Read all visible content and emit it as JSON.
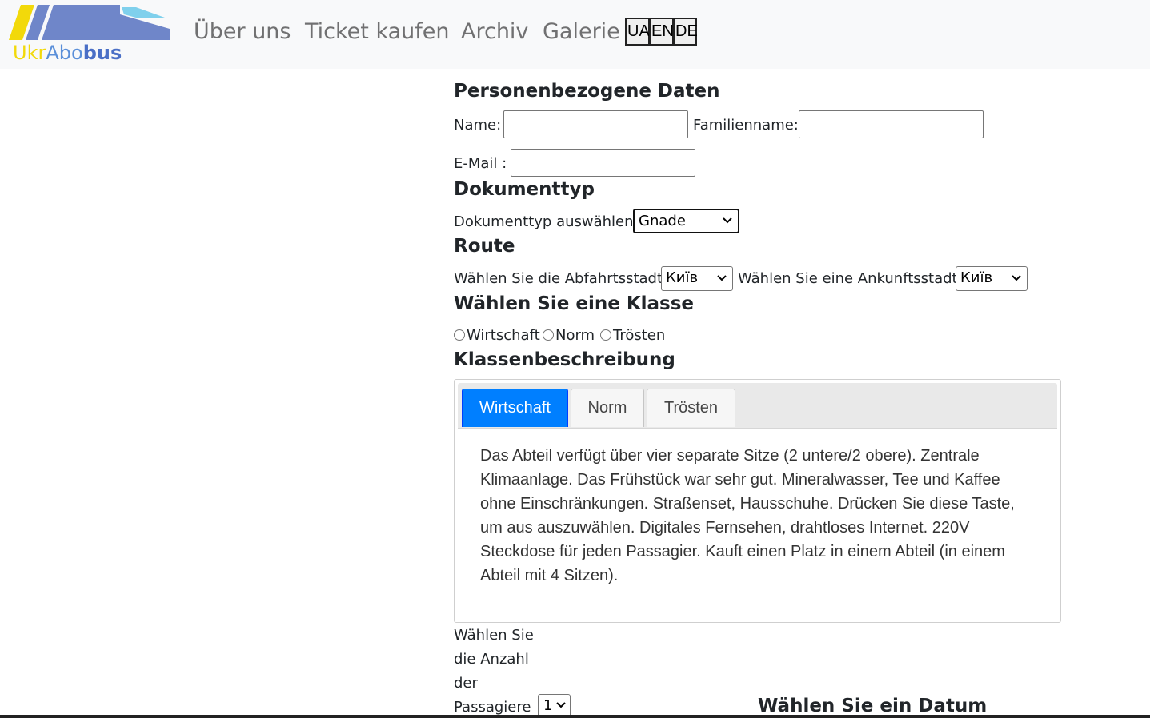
{
  "brand": {
    "logo_text_ukr": "Ukr",
    "logo_text_abo": "Abo",
    "logo_text_bus": "bus",
    "colors": {
      "yellow": "#f2d90a",
      "blue": "#6f86c9",
      "light_blue": "#7fd0ec"
    }
  },
  "nav": {
    "links": [
      "Über uns",
      "Ticket kaufen",
      "Archiv",
      "Galerie"
    ],
    "languages": [
      "UA",
      "EN",
      "DE"
    ]
  },
  "personal": {
    "heading": "Personenbezogene Daten",
    "name_label": "Name:",
    "name_value": "",
    "surname_label": "Familienname:",
    "surname_value": "",
    "email_label": "E-Mail :",
    "email_value": ""
  },
  "document": {
    "heading": "Dokumenttyp",
    "select_label": "Dokumenttyp auswählen",
    "selected": "Gnade"
  },
  "route": {
    "heading": "Route",
    "departure_label": "Wählen Sie die Abfahrtsstadt",
    "departure_selected": "Київ",
    "arrival_label": "Wählen Sie eine Ankunftsstadt",
    "arrival_selected": "Київ"
  },
  "class_select": {
    "heading": "Wählen Sie eine Klasse",
    "options": [
      "Wirtschaft",
      "Norm",
      "Trösten"
    ]
  },
  "class_description": {
    "heading": "Klassenbeschreibung",
    "tabs": [
      "Wirtschaft",
      "Norm",
      "Trösten"
    ],
    "active_tab": "Wirtschaft",
    "text": "Das Abteil verfügt über vier separate Sitze (2 untere/2 obere). Zentrale Klimaanlage. Das Frühstück war sehr gut. Mineralwasser, Tee und Kaffee ohne Einschränkungen. Straßenset, Hausschuhe. Drücken Sie diese Taste, um aus auszuwählen. Digitales Fernsehen, drahtloses Internet. 220V Steckdose für jeden Passagier. Kauft einen Platz in einem Abteil (in einem Abteil mit 4 Sitzen).",
    "active_color": "#007fff"
  },
  "passengers": {
    "label_lines": [
      "Wählen Sie",
      "die Anzahl",
      "der",
      "Passagiere"
    ],
    "selected": "1"
  },
  "date": {
    "heading": "Wählen Sie ein Datum"
  }
}
